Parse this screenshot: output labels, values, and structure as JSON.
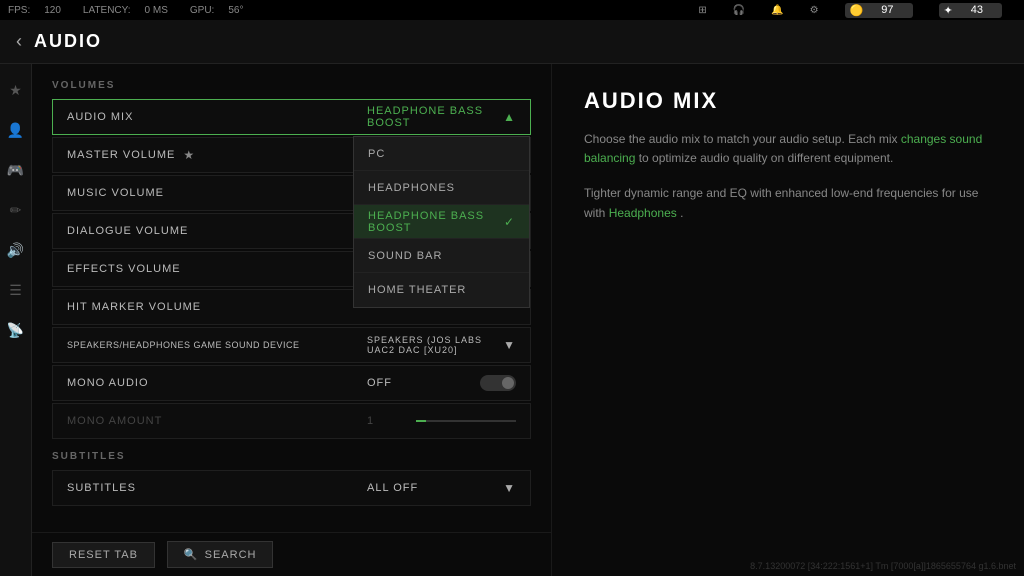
{
  "topbar": {
    "fps_label": "FPS:",
    "fps_value": "120",
    "latency_label": "LATENCY:",
    "latency_value": "0 MS",
    "gpu_label": "GPU:",
    "gpu_value": "56°",
    "coins": "97",
    "points": "43"
  },
  "header": {
    "back_icon": "‹",
    "title": "AUDIO"
  },
  "sections": {
    "volumes_label": "VOLUMES",
    "subtitles_label": "SUBTITLES"
  },
  "rows": [
    {
      "label": "AUDIO MIX",
      "value": "HEADPHONE BASS BOOST",
      "type": "dropdown-open",
      "starred": false
    },
    {
      "label": "MASTER VOLUME",
      "value": "",
      "type": "slider-star",
      "starred": true
    },
    {
      "label": "MUSIC VOLUME",
      "value": "",
      "type": "slider",
      "starred": false
    },
    {
      "label": "DIALOGUE VOLUME",
      "value": "",
      "type": "slider",
      "starred": false
    },
    {
      "label": "EFFECTS VOLUME",
      "value": "",
      "type": "slider",
      "starred": false
    },
    {
      "label": "HIT MARKER VOLUME",
      "value": "",
      "type": "slider",
      "starred": false
    },
    {
      "label": "SPEAKERS/HEADPHONES GAME SOUND DEVICE",
      "value": "SPEAKERS (JOS LABS UAC2 DAC [XU20]",
      "type": "device",
      "starred": false
    },
    {
      "label": "MONO AUDIO",
      "value": "OFF",
      "type": "toggle",
      "starred": false
    },
    {
      "label": "MONO AMOUNT",
      "value": "1",
      "type": "slider-dimmed",
      "starred": false
    }
  ],
  "dropdown_items": [
    {
      "label": "PC",
      "selected": false
    },
    {
      "label": "HEADPHONES",
      "selected": false
    },
    {
      "label": "HEADPHONE BASS BOOST",
      "selected": true
    },
    {
      "label": "SOUND BAR",
      "selected": false
    },
    {
      "label": "HOME THEATER",
      "selected": false
    }
  ],
  "subtitles_row": {
    "label": "SUBTITLES",
    "value": "ALL OFF"
  },
  "buttons": {
    "reset_label": "RESET TAB",
    "search_label": "SEARCH",
    "search_icon": "🔍"
  },
  "right_panel": {
    "title": "AUDIO MIX",
    "description_1": "Choose the audio mix to match your audio setup. Each mix",
    "link_1": "changes sound balancing",
    "description_2": "to optimize audio quality on different equipment.",
    "description_3": "Tighter dynamic range and EQ with enhanced low-end frequencies for use with",
    "link_2": "Headphones",
    "description_4": "."
  },
  "version": "8.7.13200072 [34:222:1561+1] Tm [7000[a]]1865655764 g1.6.bnet"
}
